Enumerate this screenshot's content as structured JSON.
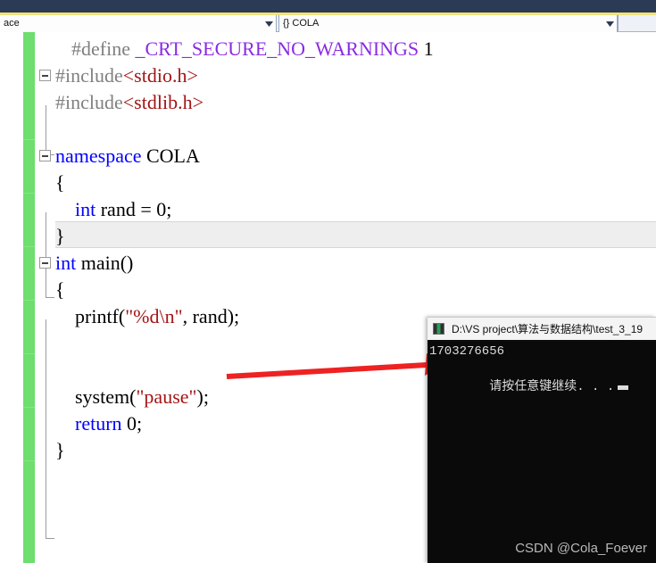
{
  "theme": {
    "header_bg": "#2b3a55",
    "header_accent": "#f2e27a",
    "change_bar_green": "#6ede6e",
    "arrow_red": "#ee2222",
    "keyword_blue": "#0000ff",
    "string_red": "#a31515",
    "macro_purple": "#8a2be2",
    "preproc_gray": "#808080",
    "console_bg": "#0a0a0a",
    "current_line_bg": "#eeeeee"
  },
  "navbar": {
    "scope_combo": {
      "value": "ace",
      "dropdown_icon": "chevron-down-icon"
    },
    "member_combo": {
      "value": "{} COLA",
      "dropdown_icon": "chevron-down-icon"
    }
  },
  "editor": {
    "lines": [
      {
        "indent": 1,
        "segments": [
          {
            "text": "#define ",
            "cls": "tok-pre"
          },
          {
            "text": "_CRT_SECURE_NO_WARNINGS",
            "cls": "tok-macro"
          },
          {
            "text": " 1",
            "cls": "tok-plain"
          }
        ]
      },
      {
        "indent": 0,
        "fold": true,
        "segments": [
          {
            "text": "#include",
            "cls": "tok-pre"
          },
          {
            "text": "<stdio.h>",
            "cls": "tok-str"
          }
        ]
      },
      {
        "indent": 0,
        "segments": [
          {
            "text": "#include",
            "cls": "tok-pre"
          },
          {
            "text": "<stdlib.h>",
            "cls": "tok-str"
          }
        ]
      },
      {
        "indent": 0,
        "segments": []
      },
      {
        "indent": 0,
        "fold": true,
        "segments": [
          {
            "text": "namespace",
            "cls": "tok-kw"
          },
          {
            "text": " COLA",
            "cls": "tok-plain"
          }
        ]
      },
      {
        "indent": 0,
        "segments": [
          {
            "text": "{",
            "cls": "tok-plain"
          }
        ]
      },
      {
        "indent": 0,
        "segments": [
          {
            "text": "    int",
            "cls": "tok-kw"
          },
          {
            "text": " rand = 0;",
            "cls": "tok-plain"
          }
        ]
      },
      {
        "indent": 0,
        "highlight": true,
        "segments": [
          {
            "text": "}",
            "cls": "tok-plain"
          }
        ]
      },
      {
        "indent": 0,
        "fold": true,
        "segments": [
          {
            "text": "int",
            "cls": "tok-kw"
          },
          {
            "text": " main()",
            "cls": "tok-plain"
          }
        ]
      },
      {
        "indent": 0,
        "segments": [
          {
            "text": "{",
            "cls": "tok-plain"
          }
        ]
      },
      {
        "indent": 0,
        "segments": [
          {
            "text": "    printf(",
            "cls": "tok-plain"
          },
          {
            "text": "\"%d\\n\"",
            "cls": "tok-str"
          },
          {
            "text": ", rand);",
            "cls": "tok-plain"
          }
        ]
      },
      {
        "indent": 0,
        "segments": []
      },
      {
        "indent": 0,
        "segments": []
      },
      {
        "indent": 0,
        "segments": [
          {
            "text": "    system(",
            "cls": "tok-plain"
          },
          {
            "text": "\"pause\"",
            "cls": "tok-str"
          },
          {
            "text": ");",
            "cls": "tok-plain"
          }
        ]
      },
      {
        "indent": 0,
        "segments": [
          {
            "text": "    return",
            "cls": "tok-kw"
          },
          {
            "text": " 0;",
            "cls": "tok-plain"
          }
        ]
      },
      {
        "indent": 0,
        "segments": [
          {
            "text": "}",
            "cls": "tok-plain"
          }
        ]
      }
    ]
  },
  "annotation": {
    "arrow_name": "red-pointer-arrow",
    "color": "#ee2222"
  },
  "console": {
    "title": "D:\\VS project\\算法与数据结构\\test_3_19",
    "icon": "console-window-icon",
    "output_line_1": "1703276656",
    "output_line_2": "请按任意键继续. . .",
    "cursor": "block-cursor"
  },
  "watermark": {
    "text": "CSDN @Cola_Foever"
  }
}
